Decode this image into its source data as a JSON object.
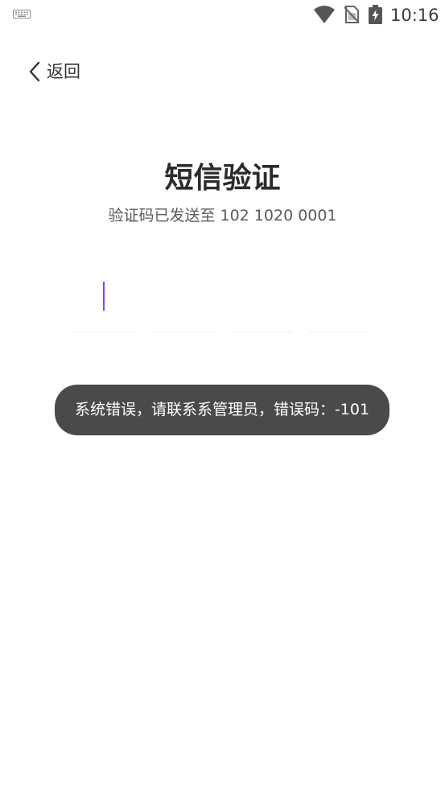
{
  "status_bar": {
    "time": "10:16",
    "icons": [
      "keyboard-icon",
      "wifi-icon",
      "no-sim-icon",
      "battery-charging-icon"
    ]
  },
  "nav": {
    "back_label": "返回"
  },
  "verification": {
    "title": "短信验证",
    "subtitle": "验证码已发送至 102 1020 0001",
    "code_slots": [
      "",
      "",
      "",
      ""
    ],
    "accent_color": "#8a3ffc"
  },
  "toast": {
    "message": "系统错误，请联系系管理员，错误码：-101"
  }
}
